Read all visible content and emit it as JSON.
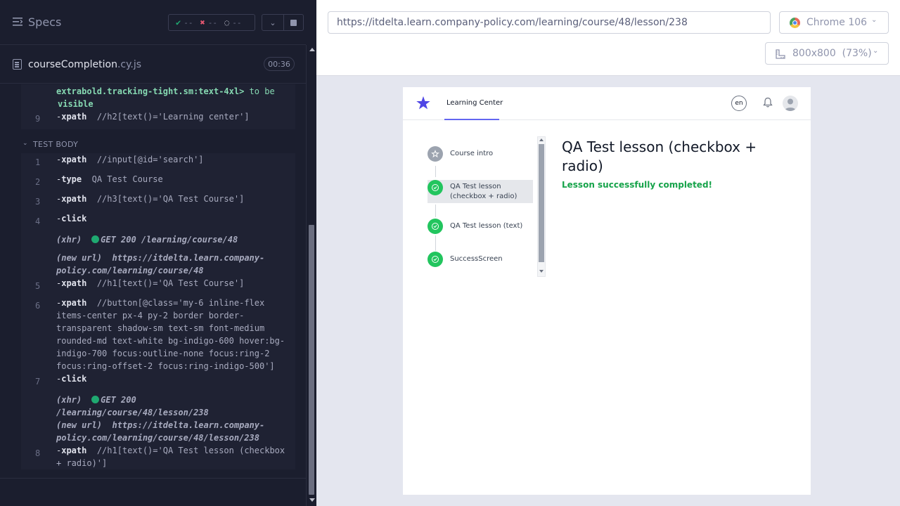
{
  "runner": {
    "specs_title": "Specs",
    "stats": {
      "passed": "--",
      "failed": "--",
      "pending": "--"
    },
    "file": {
      "name": "courseCompletion",
      "ext": ".cy.js",
      "duration": "00:36"
    },
    "before_cmds": {
      "partial_line": "extrabold.tracking-tight.sm:text-4xl>",
      "assert_tail_1": "to be",
      "assert_tail_2": "visible",
      "cmd9": {
        "num": "9",
        "name": "xpath",
        "arg": "//h2[text()='Learning center']"
      }
    },
    "section_label": "TEST BODY",
    "commands": [
      {
        "num": "1",
        "name": "xpath",
        "arg": "//input[@id='search']"
      },
      {
        "num": "2",
        "name": "type",
        "arg": "QA Test Course"
      },
      {
        "num": "3",
        "name": "xpath",
        "arg": "//h3[text()='QA Test Course']"
      },
      {
        "num": "4",
        "name": "click",
        "arg": ""
      },
      {
        "num": "5",
        "name": "xpath",
        "arg": "//h1[text()='QA Test Course']"
      },
      {
        "num": "6",
        "name": "xpath",
        "arg": "//button[@class='my-6 inline-flex items-center px-4 py-2 border border-transparent shadow-sm text-sm font-medium rounded-md text-white bg-indigo-600 hover:bg-indigo-700 focus:outline-none focus:ring-2 focus:ring-offset-2 focus:ring-indigo-500']"
      },
      {
        "num": "7",
        "name": "click",
        "arg": ""
      },
      {
        "num": "8",
        "name": "xpath",
        "arg": "//h1[text()='QA Test lesson (checkbox + radio)']"
      }
    ],
    "events": {
      "xhr1": {
        "label": "(xhr)",
        "text": "GET 200 /learning/course/48"
      },
      "url1": {
        "label": "(new url)",
        "text": "https://itdelta.learn.company-policy.com/learning/course/48"
      },
      "xhr2": {
        "label": "(xhr)",
        "text": "GET 200 /learning/course/48/lesson/238"
      },
      "url2": {
        "label": "(new url)",
        "text": "https://itdelta.learn.company-policy.com/learning/course/48/lesson/238"
      }
    }
  },
  "topbar": {
    "url": "https://itdelta.learn.company-policy.com/learning/course/48/lesson/238",
    "browser": "Chrome 106",
    "viewport": "800x800",
    "zoom": "(73%)"
  },
  "app": {
    "nav_item": "Learning Center",
    "lang": "en",
    "steps": [
      {
        "label": "Course intro",
        "state": "star"
      },
      {
        "label": "QA Test lesson (checkbox + radio)",
        "state": "done"
      },
      {
        "label": "QA Test lesson (text)",
        "state": "done"
      },
      {
        "label": "SuccessScreen",
        "state": "done"
      }
    ],
    "lesson_title": "QA Test lesson (checkbox + radio)",
    "status_message": "Lesson successfully completed!"
  },
  "colors": {
    "runner_bg": "#1b1e2e",
    "pass": "#1fa971",
    "fail": "#e45770",
    "accent": "#6366f1",
    "success_text": "#16a34a"
  }
}
